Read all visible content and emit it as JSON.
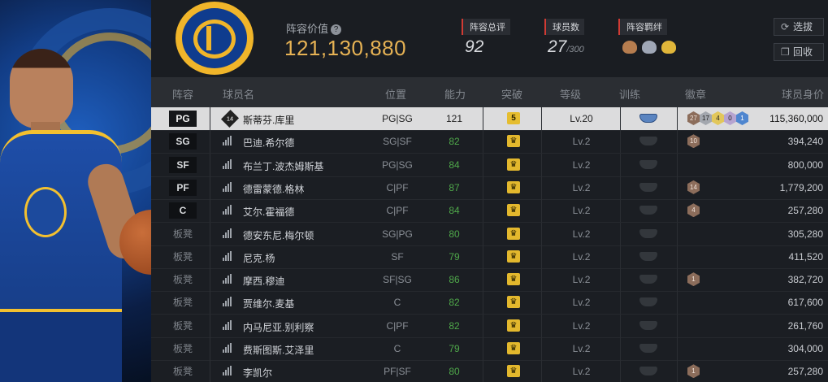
{
  "header": {
    "value_label": "阵容价值",
    "value_help_icon": "question-icon",
    "value": "121,130,880",
    "rating_label": "阵容总评",
    "rating_value": "92",
    "players_label": "球员数",
    "players_value": "27",
    "players_max": "/300",
    "bond_label": "阵容羁绊",
    "bond_icons": [
      "bond-two-person-icon",
      "bond-three-person-icon",
      "bond-group-icon"
    ],
    "filter_button": "选拔",
    "recycle_button": "回收",
    "accent_color": "#e6b254"
  },
  "columns": [
    "阵容",
    "球员名",
    "位置",
    "能力",
    "突破",
    "等级",
    "训练",
    "徽章",
    "球员身价"
  ],
  "rows": [
    {
      "slot": "PG",
      "name": "斯蒂芬.库里",
      "ovr_icon": "14",
      "position": "PG|SG",
      "ability": "121",
      "breakthrough": "5",
      "level": "Lv.20",
      "badges": [
        "27",
        "17",
        "4",
        "0",
        "1"
      ],
      "salary": "115,360,000",
      "selected": true
    },
    {
      "slot": "SG",
      "name": "巴迪.希尔德",
      "position": "SG|SF",
      "ability": "82",
      "breakthrough": "",
      "level": "Lv.2",
      "badges": [
        "10"
      ],
      "salary": "394,240"
    },
    {
      "slot": "SF",
      "name": "布兰丁.波杰姆斯基",
      "position": "PG|SG",
      "ability": "84",
      "breakthrough": "",
      "level": "Lv.2",
      "badges": [],
      "salary": "800,000"
    },
    {
      "slot": "PF",
      "name": "德雷蒙德.格林",
      "position": "C|PF",
      "ability": "87",
      "breakthrough": "",
      "level": "Lv.2",
      "badges": [
        "14"
      ],
      "salary": "1,779,200"
    },
    {
      "slot": "C",
      "name": "艾尔.霍福德",
      "position": "C|PF",
      "ability": "84",
      "breakthrough": "",
      "level": "Lv.2",
      "badges": [
        "4"
      ],
      "salary": "257,280"
    },
    {
      "slot": "板凳",
      "name": "德安东尼.梅尔顿",
      "position": "SG|PG",
      "ability": "80",
      "breakthrough": "",
      "level": "Lv.2",
      "badges": [],
      "salary": "305,280"
    },
    {
      "slot": "板凳",
      "name": "尼克.杨",
      "position": "SF",
      "ability": "79",
      "breakthrough": "",
      "level": "Lv.2",
      "badges": [],
      "salary": "411,520"
    },
    {
      "slot": "板凳",
      "name": "摩西.穆迪",
      "position": "SF|SG",
      "ability": "86",
      "breakthrough": "",
      "level": "Lv.2",
      "badges": [
        "1"
      ],
      "salary": "382,720"
    },
    {
      "slot": "板凳",
      "name": "贾维尔.麦基",
      "position": "C",
      "ability": "82",
      "breakthrough": "",
      "level": "Lv.2",
      "badges": [],
      "salary": "617,600"
    },
    {
      "slot": "板凳",
      "name": "内马尼亚.别利察",
      "position": "C|PF",
      "ability": "82",
      "breakthrough": "",
      "level": "Lv.2",
      "badges": [],
      "salary": "261,760"
    },
    {
      "slot": "板凳",
      "name": "费斯图斯.艾泽里",
      "position": "C",
      "ability": "79",
      "breakthrough": "",
      "level": "Lv.2",
      "badges": [],
      "salary": "304,000"
    },
    {
      "slot": "板凳",
      "name": "李凯尔",
      "position": "PF|SF",
      "ability": "80",
      "breakthrough": "",
      "level": "Lv.2",
      "badges": [
        "1"
      ],
      "salary": "257,280"
    }
  ]
}
